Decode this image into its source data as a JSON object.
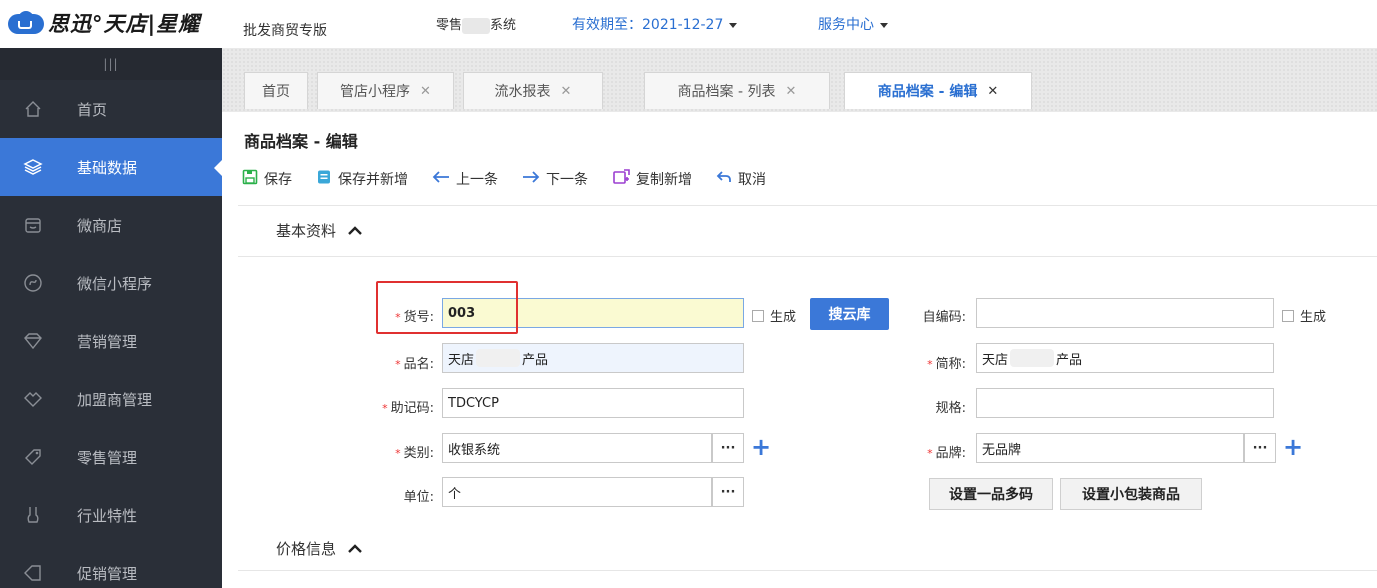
{
  "header": {
    "brand": "思迅°天店|星耀",
    "edition": "批发商贸专版",
    "product_prefix": "零售",
    "product_suffix": "系统",
    "validity": "有效期至：2021-12-27",
    "service": "服务中心"
  },
  "sidebar": {
    "toggle": "|||",
    "items": [
      {
        "label": "首页",
        "icon": "home-icon"
      },
      {
        "label": "基础数据",
        "icon": "layers-icon"
      },
      {
        "label": "微商店",
        "icon": "store-icon"
      },
      {
        "label": "微信小程序",
        "icon": "miniprogram-icon"
      },
      {
        "label": "营销管理",
        "icon": "diamond-icon"
      },
      {
        "label": "加盟商管理",
        "icon": "handshake-icon"
      },
      {
        "label": "零售管理",
        "icon": "tag-icon"
      },
      {
        "label": "行业特性",
        "icon": "industry-icon"
      },
      {
        "label": "促销管理",
        "icon": "promo-icon"
      }
    ]
  },
  "tabs": [
    {
      "label": "首页"
    },
    {
      "label": "管店小程序",
      "close": "✕"
    },
    {
      "label": "流水报表",
      "close": "✕"
    },
    {
      "label": "商品档案 - 列表",
      "close": "✕"
    },
    {
      "label": "商品档案 - 编辑",
      "close": "✕"
    }
  ],
  "page": {
    "title": "商品档案 - 编辑"
  },
  "toolbar": {
    "save": "保存",
    "save_new": "保存并新增",
    "prev": "上一条",
    "next": "下一条",
    "copy_new": "复制新增",
    "cancel": "取消"
  },
  "sections": {
    "basic": "基本资料",
    "price": "价格信息"
  },
  "form": {
    "item_no_label": "货号:",
    "item_no_value": "003",
    "generate": "生成",
    "search_cloud": "搜云库",
    "self_code_label": "自编码:",
    "self_code_value": "",
    "name_label": "品名:",
    "name_prefix": "天店",
    "name_suffix": "产品",
    "short_label": "简称:",
    "short_prefix": "天店",
    "short_suffix": "产品",
    "mnemonic_label": "助记码:",
    "mnemonic_value": "TDCYCP",
    "spec_label": "规格:",
    "spec_value": "",
    "category_label": "类别:",
    "category_value": "收银系统",
    "brand_label": "品牌:",
    "brand_value": "无品牌",
    "unit_label": "单位:",
    "unit_value": "个",
    "multi_code": "设置一品多码",
    "small_pack": "设置小包装商品",
    "dots": "···",
    "plus": "+"
  }
}
